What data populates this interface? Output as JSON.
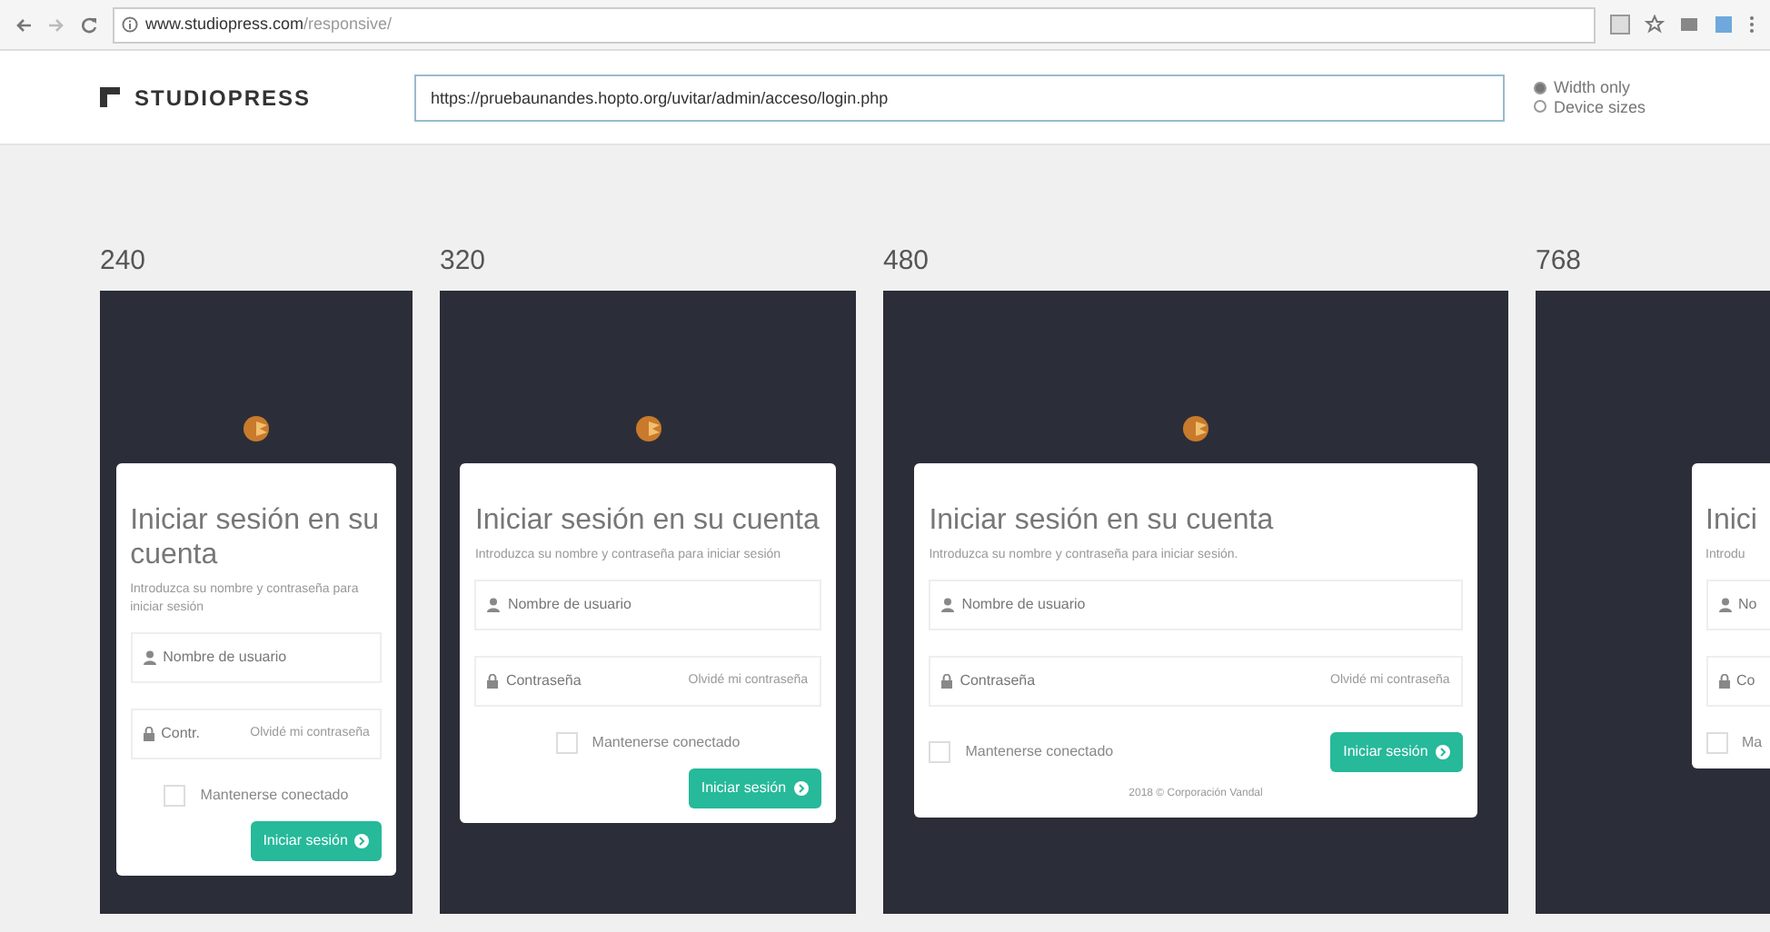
{
  "browser": {
    "url_host": "www.studiopress.com",
    "url_path": "/responsive/"
  },
  "header": {
    "brand": "STUDIOPRESS",
    "test_url": "https://pruebaunandes.hopto.org/uvitar/admin/acceso/login.php",
    "size_options": [
      {
        "label": "Width only",
        "selected": true
      },
      {
        "label": "Device sizes",
        "selected": false
      }
    ]
  },
  "frames": [
    {
      "label": "240",
      "logo": true,
      "title": "Iniciar sesión en su cuenta",
      "subtitle": "Introduzca su nombre y contraseña para iniciar sesión",
      "username": "Nombre de usuario",
      "password": "Contr.",
      "forgot": "Olvidé mi contraseña",
      "remember": "Mantenerse conectado",
      "remember_checked": false,
      "button": "Iniciar sesión"
    },
    {
      "label": "320",
      "logo": true,
      "title": "Iniciar sesión en su cuenta",
      "subtitle": "Introduzca su nombre y contraseña para iniciar sesión",
      "username": "Nombre de usuario",
      "password": "Contraseña",
      "forgot": "Olvidé mi contraseña",
      "remember": "Mantenerse conectado",
      "remember_checked": false,
      "button": "Iniciar sesión"
    },
    {
      "label": "480",
      "logo": true,
      "title": "Iniciar sesión en su cuenta",
      "subtitle": "Introduzca su nombre y contraseña para iniciar sesión.",
      "username": "Nombre de usuario",
      "password": "Contraseña",
      "forgot": "Olvidé mi contraseña",
      "remember": "Mantenerse conectado",
      "remember_checked": false,
      "button": "Iniciar sesión",
      "footer": "2018 © Corporación Vandal"
    },
    {
      "label": "768",
      "title": "Inici",
      "subtitle": "Introdu",
      "username": "No",
      "password": "Co",
      "remember": "Ma",
      "remember_checked": false
    }
  ]
}
